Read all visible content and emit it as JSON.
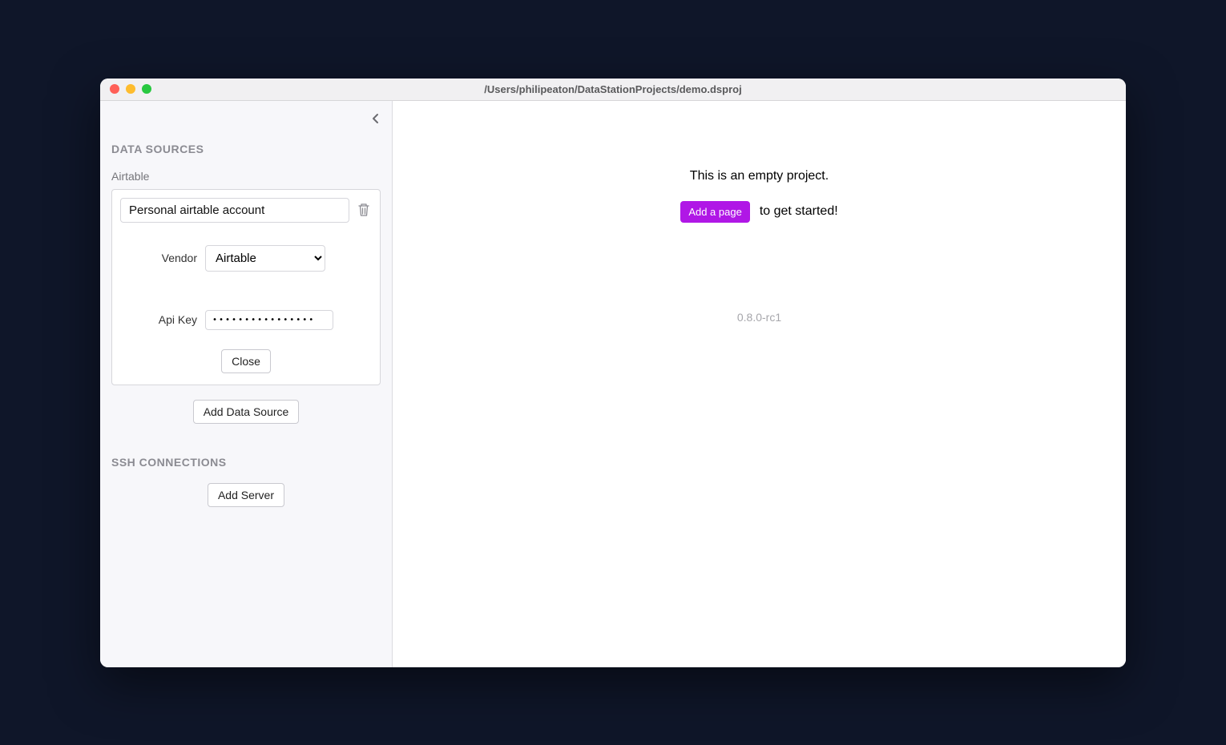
{
  "window": {
    "title": "/Users/philipeaton/DataStationProjects/demo.dsproj"
  },
  "sidebar": {
    "sections": {
      "dataSources": {
        "title": "DATA SOURCES",
        "typeLabel": "Airtable",
        "item": {
          "name": "Personal airtable account",
          "vendorLabel": "Vendor",
          "vendorValue": "Airtable",
          "apiKeyLabel": "Api Key",
          "apiKeyValue": "••••••••••••••••",
          "closeLabel": "Close"
        },
        "addLabel": "Add Data Source"
      },
      "ssh": {
        "title": "SSH CONNECTIONS",
        "addLabel": "Add Server"
      }
    }
  },
  "main": {
    "emptyTitle": "This is an empty project.",
    "addPageLabel": "Add a page",
    "getStartedText": "to get started!",
    "version": "0.8.0-rc1"
  }
}
